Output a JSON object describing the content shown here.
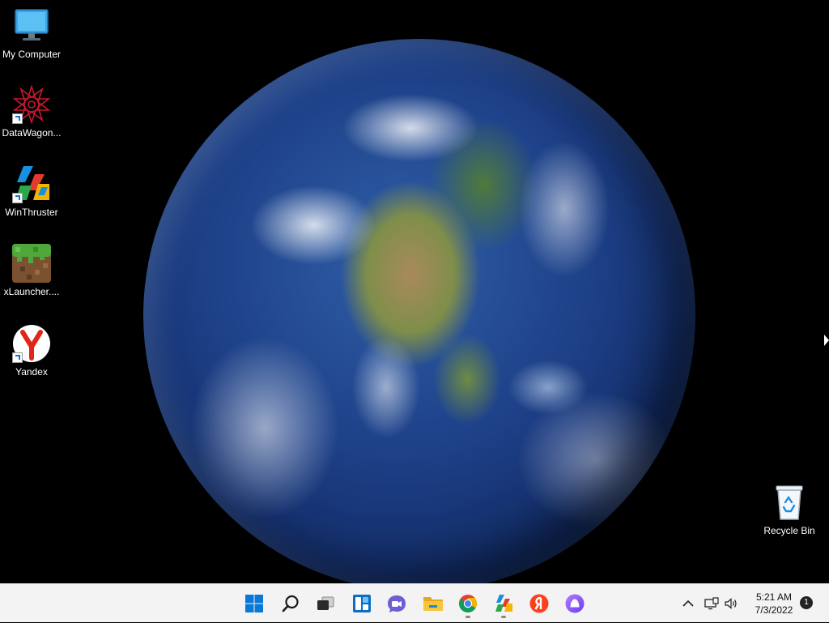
{
  "desktop": {
    "icons": [
      {
        "label": "My Computer",
        "icon": "monitor-icon",
        "shortcut": false
      },
      {
        "label": "DataWagon...",
        "icon": "datawagon-star-icon",
        "shortcut": true
      },
      {
        "label": "WinThruster",
        "icon": "winthruster-icon",
        "shortcut": true
      },
      {
        "label": "xLauncher....",
        "icon": "minecraft-grass-block-icon",
        "shortcut": false
      },
      {
        "label": "Yandex",
        "icon": "yandex-browser-icon",
        "shortcut": true
      },
      {
        "label": "Recycle Bin",
        "icon": "recycle-bin-icon",
        "shortcut": false
      }
    ]
  },
  "taskbar": {
    "apps": [
      {
        "name": "Start",
        "icon": "windows-logo-icon",
        "running": false
      },
      {
        "name": "Search",
        "icon": "search-icon",
        "running": false
      },
      {
        "name": "Task View",
        "icon": "task-view-icon",
        "running": false
      },
      {
        "name": "Widgets",
        "icon": "widgets-icon",
        "running": false
      },
      {
        "name": "Chat",
        "icon": "chat-icon",
        "running": false
      },
      {
        "name": "File Explorer",
        "icon": "folder-icon",
        "running": false
      },
      {
        "name": "Google Chrome",
        "icon": "chrome-icon",
        "running": true
      },
      {
        "name": "WinThruster",
        "icon": "winthruster-icon",
        "running": true
      },
      {
        "name": "Yandex Browser",
        "icon": "yandex-browser-icon",
        "running": false
      },
      {
        "name": "Alice",
        "icon": "alice-assistant-icon",
        "running": false
      }
    ],
    "tray": {
      "overflow_icon": "chevron-up-icon",
      "network_icon": "network-icon",
      "volume_icon": "speaker-icon",
      "time": "5:21 AM",
      "date": "7/3/2022",
      "notification_count": "1"
    }
  },
  "colors": {
    "taskbar_bg": "#f3f3f3",
    "accent_blue": "#0078d4",
    "yandex_red": "#fc3f1d",
    "alice_purple": "#8f5cff"
  }
}
